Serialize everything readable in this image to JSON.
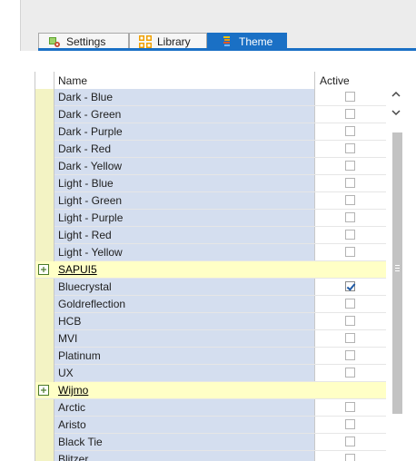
{
  "tabs": [
    {
      "label": "Settings",
      "icon": "settings-icon",
      "active": false
    },
    {
      "label": "Library",
      "icon": "library-icon",
      "active": false
    },
    {
      "label": "Theme",
      "icon": "theme-icon",
      "active": true
    }
  ],
  "grid": {
    "columns": {
      "name": "Name",
      "active": "Active"
    },
    "items": [
      {
        "type": "row",
        "name": "Dark - Blue",
        "active": false
      },
      {
        "type": "row",
        "name": "Dark - Green",
        "active": false
      },
      {
        "type": "row",
        "name": "Dark - Purple",
        "active": false
      },
      {
        "type": "row",
        "name": "Dark - Red",
        "active": false
      },
      {
        "type": "row",
        "name": "Dark - Yellow",
        "active": false
      },
      {
        "type": "row",
        "name": "Light - Blue",
        "active": false
      },
      {
        "type": "row",
        "name": "Light - Green",
        "active": false
      },
      {
        "type": "row",
        "name": "Light - Purple",
        "active": false
      },
      {
        "type": "row",
        "name": "Light - Red",
        "active": false
      },
      {
        "type": "row",
        "name": "Light - Yellow",
        "active": false
      },
      {
        "type": "group",
        "name": "SAPUI5"
      },
      {
        "type": "row",
        "name": "Bluecrystal",
        "active": true
      },
      {
        "type": "row",
        "name": "Goldreflection",
        "active": false
      },
      {
        "type": "row",
        "name": "HCB",
        "active": false
      },
      {
        "type": "row",
        "name": "MVI",
        "active": false
      },
      {
        "type": "row",
        "name": "Platinum",
        "active": false
      },
      {
        "type": "row",
        "name": "UX",
        "active": false
      },
      {
        "type": "group",
        "name": "Wijmo"
      },
      {
        "type": "row",
        "name": "Arctic",
        "active": false
      },
      {
        "type": "row",
        "name": "Aristo",
        "active": false
      },
      {
        "type": "row",
        "name": "Black Tie",
        "active": false
      },
      {
        "type": "row",
        "name": "Blitzer",
        "active": false
      }
    ]
  },
  "colors": {
    "accent": "#1a70c5",
    "row_name_bg": "#d4deef",
    "group_bg": "#ffffc6",
    "indicator_bg": "#f3f3c4"
  }
}
